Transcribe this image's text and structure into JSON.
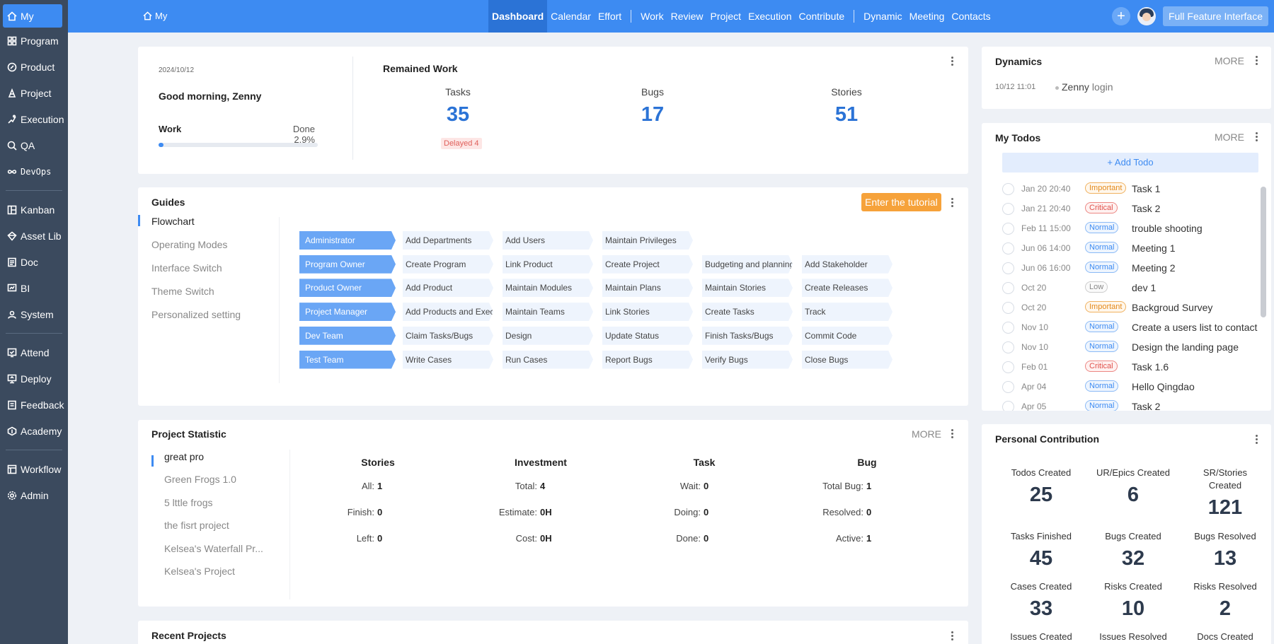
{
  "sidebar": {
    "items": [
      {
        "label": "My",
        "icon": "home-icon"
      },
      {
        "label": "Program",
        "icon": "grid-icon"
      },
      {
        "label": "Product",
        "icon": "product-icon"
      },
      {
        "label": "Project",
        "icon": "project-icon"
      },
      {
        "label": "Execution",
        "icon": "run-icon"
      },
      {
        "label": "QA",
        "icon": "search-icon"
      },
      {
        "label": "DevOps",
        "icon": "infinity-icon"
      },
      {
        "label": "Kanban",
        "icon": "kanban-icon"
      },
      {
        "label": "Asset Lib",
        "icon": "diamond-icon"
      },
      {
        "label": "Doc",
        "icon": "doc-icon"
      },
      {
        "label": "BI",
        "icon": "chart-icon"
      },
      {
        "label": "System",
        "icon": "users-icon"
      },
      {
        "label": "Attend",
        "icon": "attend-icon"
      },
      {
        "label": "Deploy",
        "icon": "deploy-icon"
      },
      {
        "label": "Feedback",
        "icon": "feedback-icon"
      },
      {
        "label": "Academy",
        "icon": "academy-icon"
      },
      {
        "label": "Workflow",
        "icon": "workflow-icon"
      },
      {
        "label": "Admin",
        "icon": "gear-icon"
      }
    ]
  },
  "topbar": {
    "breadcrumb": "My",
    "tabs": [
      "Dashboard",
      "Calendar",
      "Effort",
      "Work",
      "Review",
      "Project",
      "Execution",
      "Contribute",
      "Dynamic",
      "Meeting",
      "Contacts"
    ],
    "active_tab": "Dashboard",
    "full_feature": "Full Feature Interface",
    "plus": "+"
  },
  "summary": {
    "date": "2024/10/12",
    "greeting": "Good morning, Zenny",
    "work_label": "Work",
    "done_label": "Done 2.9%",
    "progress": 0.029,
    "remained_title": "Remained Work",
    "stats": [
      {
        "label": "Tasks",
        "value": "35"
      },
      {
        "label": "Bugs",
        "value": "17"
      },
      {
        "label": "Stories",
        "value": "51"
      }
    ],
    "delayed": "Delayed 4"
  },
  "guides": {
    "title": "Guides",
    "enter_button": "Enter the tutorial",
    "menu": [
      "Flowchart",
      "Operating Modes",
      "Interface Switch",
      "Theme Switch",
      "Personalized setting"
    ],
    "rows": [
      {
        "role": "Administrator",
        "steps": [
          "Add Departments",
          "Add Users",
          "Maintain Privileges"
        ]
      },
      {
        "role": "Program Owner",
        "steps": [
          "Create Program",
          "Link Product",
          "Create Project",
          "Budgeting and planning",
          "Add Stakeholder"
        ]
      },
      {
        "role": "Product Owner",
        "steps": [
          "Add Product",
          "Maintain Modules",
          "Maintain Plans",
          "Maintain Stories",
          "Create Releases"
        ]
      },
      {
        "role": "Project Manager",
        "steps": [
          "Add Products and Executi",
          "Maintain Teams",
          "Link Stories",
          "Create Tasks",
          "Track"
        ]
      },
      {
        "role": "Dev Team",
        "steps": [
          "Claim Tasks/Bugs",
          "Design",
          "Update Status",
          "Finish Tasks/Bugs",
          "Commit Code"
        ]
      },
      {
        "role": "Test Team",
        "steps": [
          "Write Cases",
          "Run Cases",
          "Report Bugs",
          "Verify Bugs",
          "Close Bugs"
        ]
      }
    ]
  },
  "project_statistic": {
    "title": "Project Statistic",
    "more": "MORE",
    "projects": [
      "great pro",
      "Green Frogs 1.0",
      "5 lttle frogs",
      "the fisrt project",
      "Kelsea's Waterfall Pr...",
      "Kelsea's Project"
    ],
    "columns": [
      {
        "title": "Stories",
        "rows": [
          {
            "k": "All:",
            "v": "1"
          },
          {
            "k": "Finish:",
            "v": "0"
          },
          {
            "k": "Left:",
            "v": "0"
          }
        ]
      },
      {
        "title": "Investment",
        "rows": [
          {
            "k": "Total:",
            "v": "4"
          },
          {
            "k": "Estimate:",
            "v": "0H"
          },
          {
            "k": "Cost:",
            "v": "0H"
          }
        ]
      },
      {
        "title": "Task",
        "rows": [
          {
            "k": "Wait:",
            "v": "0"
          },
          {
            "k": "Doing:",
            "v": "0"
          },
          {
            "k": "Done:",
            "v": "0"
          }
        ]
      },
      {
        "title": "Bug",
        "rows": [
          {
            "k": "Total Bug:",
            "v": "1"
          },
          {
            "k": "Resolved:",
            "v": "0"
          },
          {
            "k": "Active:",
            "v": "1"
          }
        ]
      }
    ]
  },
  "recent_projects": {
    "title": "Recent Projects"
  },
  "dynamics": {
    "title": "Dynamics",
    "more": "MORE",
    "entry": {
      "time": "10/12 11:01",
      "user": "Zenny",
      "action": "login"
    }
  },
  "todos": {
    "title": "My Todos",
    "more": "MORE",
    "add_label": "+ Add Todo",
    "items": [
      {
        "time": "Jan 20 20:40",
        "tag": "Important",
        "kind": "important",
        "name": "Task 1"
      },
      {
        "time": "Jan 21 20:40",
        "tag": "Critical",
        "kind": "critical",
        "name": "Task 2"
      },
      {
        "time": "Feb 11 15:00",
        "tag": "Normal",
        "kind": "normal",
        "name": "trouble shooting"
      },
      {
        "time": "Jun 06 14:00",
        "tag": "Normal",
        "kind": "normal",
        "name": "Meeting 1"
      },
      {
        "time": "Jun 06 16:00",
        "tag": "Normal",
        "kind": "normal",
        "name": "Meeting 2"
      },
      {
        "time": "Oct 20",
        "tag": "Low",
        "kind": "low",
        "name": "dev 1"
      },
      {
        "time": "Oct 20",
        "tag": "Important",
        "kind": "important",
        "name": "Backgroud Survey"
      },
      {
        "time": "Nov 10",
        "tag": "Normal",
        "kind": "normal",
        "name": "Create a users list to contact"
      },
      {
        "time": "Nov 10",
        "tag": "Normal",
        "kind": "normal",
        "name": "Design the landing page"
      },
      {
        "time": "Feb 01",
        "tag": "Critical",
        "kind": "critical",
        "name": "Task 1.6"
      },
      {
        "time": "Apr 04",
        "tag": "Normal",
        "kind": "normal",
        "name": "Hello Qingdao"
      },
      {
        "time": "Apr 05",
        "tag": "Normal",
        "kind": "normal",
        "name": "Task 2"
      }
    ]
  },
  "contribution": {
    "title": "Personal Contribution",
    "items": [
      {
        "label": "Todos Created",
        "value": "25"
      },
      {
        "label": "UR/Epics Created",
        "value": "6"
      },
      {
        "label": "SR/Stories Created",
        "value": "121"
      },
      {
        "label": "Tasks Finished",
        "value": "45"
      },
      {
        "label": "Bugs Created",
        "value": "32"
      },
      {
        "label": "Bugs Resolved",
        "value": "13"
      },
      {
        "label": "Cases Created",
        "value": "33"
      },
      {
        "label": "Risks Created",
        "value": "10"
      },
      {
        "label": "Risks Resolved",
        "value": "2"
      },
      {
        "label": "Issues Created",
        "value": ""
      },
      {
        "label": "Issues Resolved",
        "value": ""
      },
      {
        "label": "Docs Created",
        "value": ""
      }
    ]
  },
  "colors": {
    "primary": "#3d8bf2",
    "sidebar": "#3b4a5e",
    "tutorial": "#f6a23a"
  }
}
